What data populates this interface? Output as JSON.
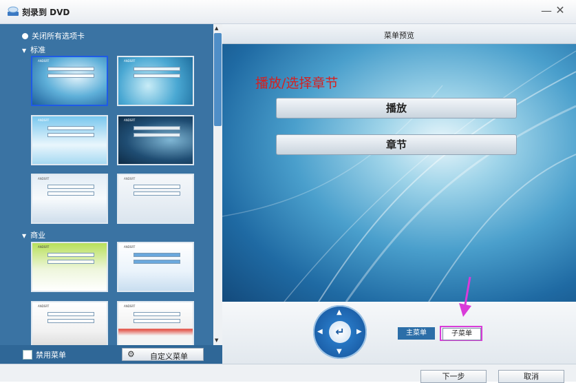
{
  "window": {
    "title": "刻录到 DVD",
    "minimize": "—",
    "close": "✕"
  },
  "sidebar": {
    "close_all": "关闭所有选项卡",
    "sections": [
      {
        "label": "标准"
      },
      {
        "label": "商业"
      }
    ],
    "thumbnail_caption": "ANDSRT",
    "disable_menu_label": "禁用菜单",
    "custom_menu_button": "自定义菜单"
  },
  "preview": {
    "header": "菜单预览",
    "heading": "播放/选择章节",
    "buttons": [
      "播放",
      "章节"
    ],
    "tabs": {
      "main": "主菜单",
      "sub": "子菜单"
    }
  },
  "nav": {
    "up": "▲",
    "down": "▼",
    "left": "◀",
    "right": "▶",
    "enter": "↵"
  },
  "footer": {
    "next": "下一步",
    "cancel": "取消"
  },
  "colors": {
    "accent": "#1e5ae8",
    "highlight": "#d93bd9",
    "heading": "#d52020"
  }
}
